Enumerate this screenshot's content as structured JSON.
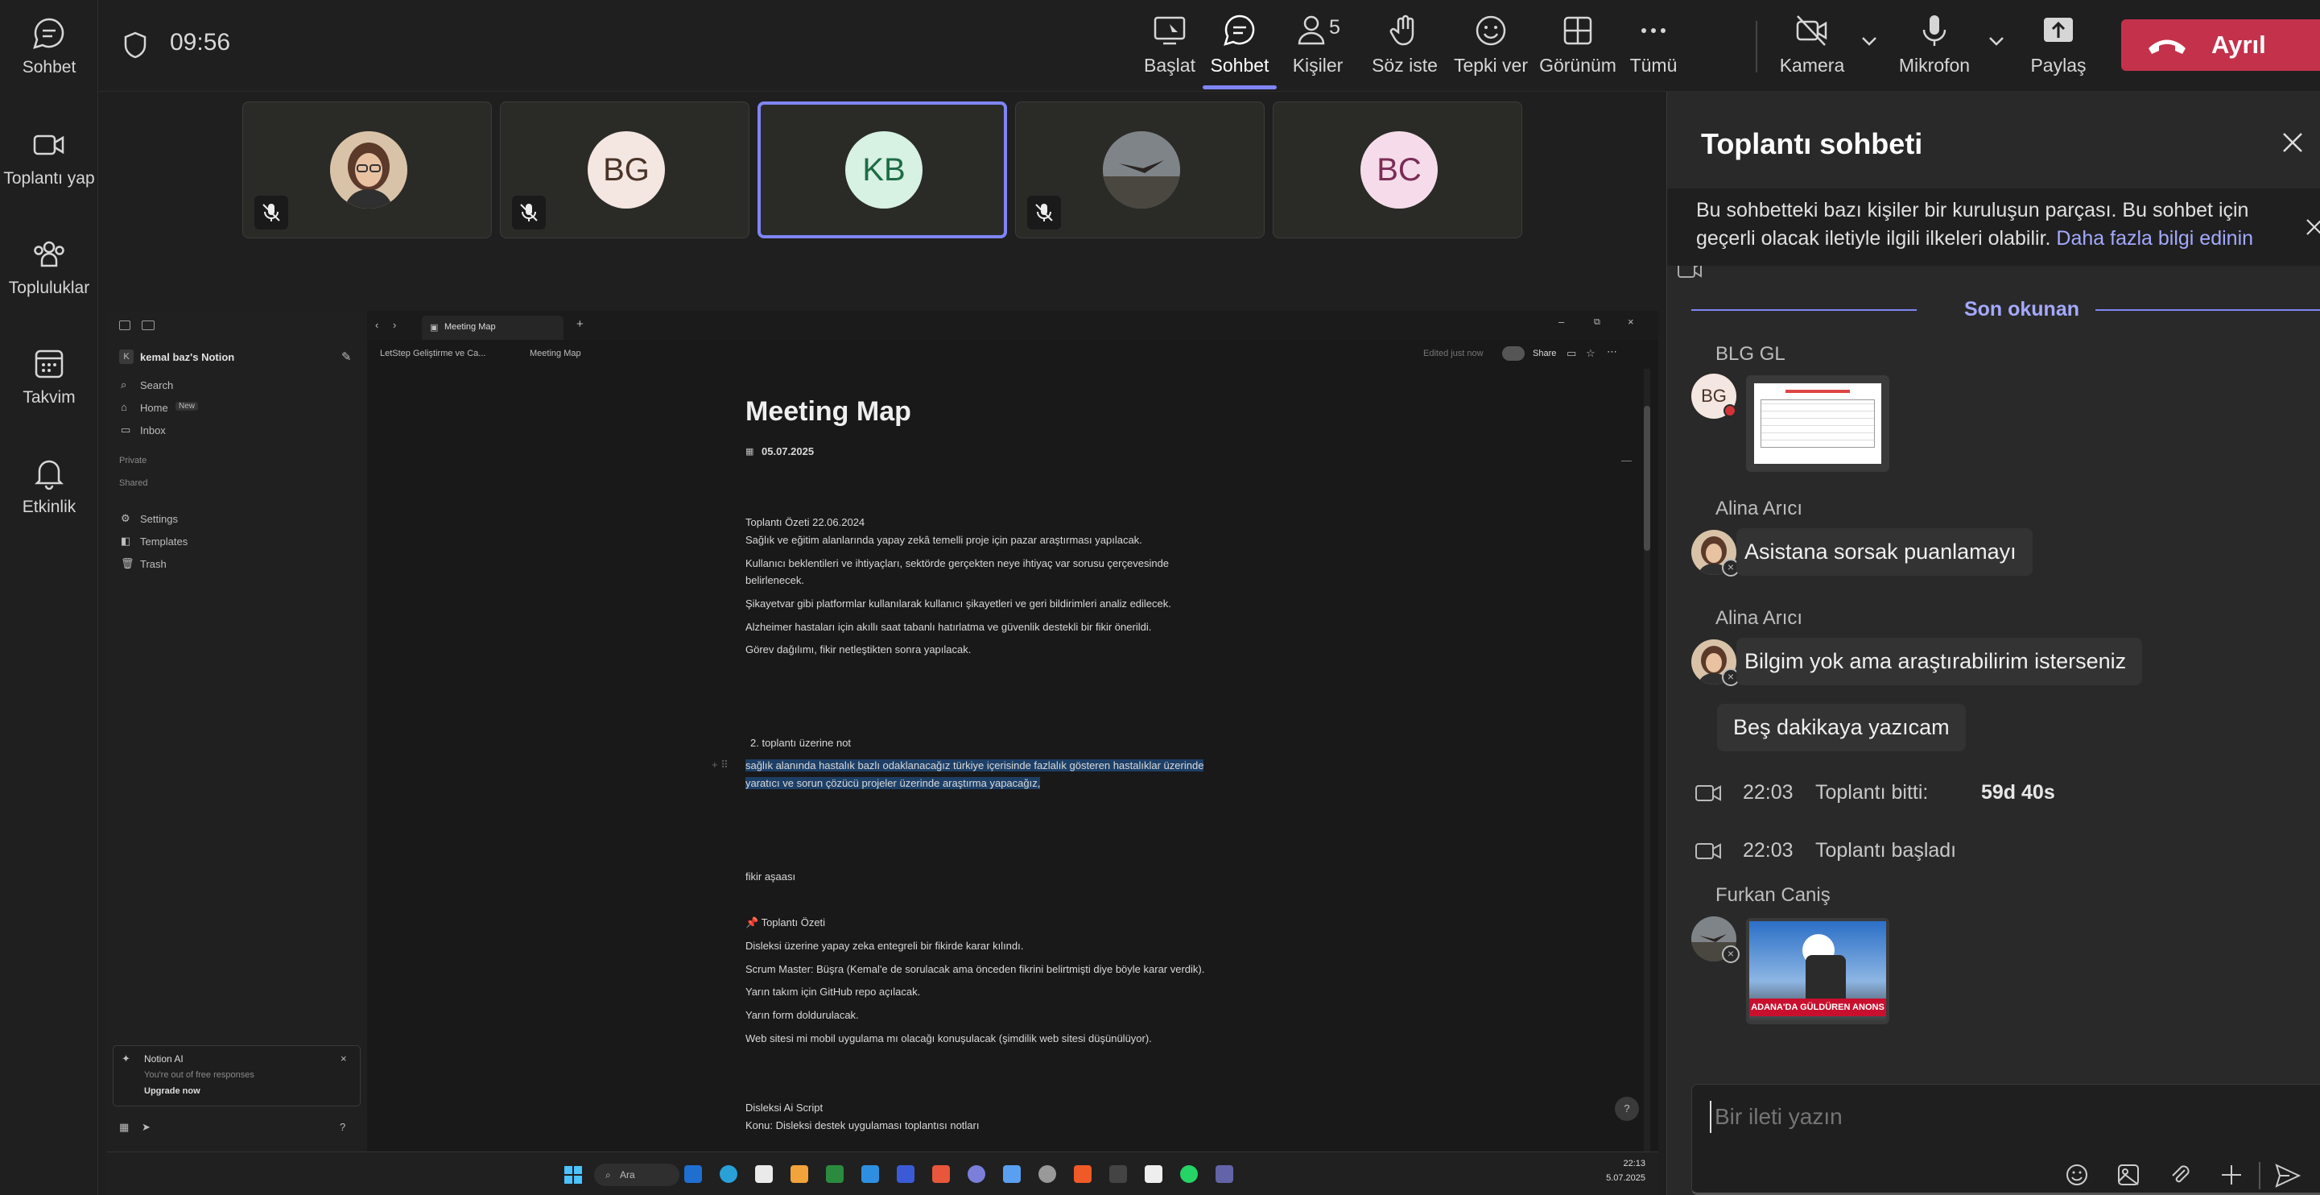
{
  "rail": {
    "items": [
      {
        "label": "Sohbet"
      },
      {
        "label": "Toplantı yap"
      },
      {
        "label": "Topluluklar"
      },
      {
        "label": "Takvim"
      },
      {
        "label": "Etkinlik"
      }
    ]
  },
  "topbar": {
    "timer": "09:56",
    "buttons": {
      "start": "Başlat",
      "chat": "Sohbet",
      "people": "Kişiler",
      "people_count": "5",
      "raise": "Söz iste",
      "react": "Tepki ver",
      "view": "Görünüm",
      "more": "Tümü",
      "camera": "Kamera",
      "mic": "Mikrofon",
      "share": "Paylaş"
    },
    "leave": "Ayrıl"
  },
  "participants": [
    {
      "initials": ""
    },
    {
      "initials": "BG"
    },
    {
      "initials": "KB"
    },
    {
      "initials": ""
    },
    {
      "initials": "BC"
    }
  ],
  "notion": {
    "workspace": "kemal baz's Notion",
    "workspace_initial": "K",
    "nav": {
      "search": "Search",
      "home": "Home",
      "home_badge": "New",
      "inbox": "Inbox"
    },
    "sections": {
      "private": "Private",
      "shared": "Shared"
    },
    "settings": {
      "settings": "Settings",
      "templates": "Templates",
      "trash": "Trash"
    },
    "ai": {
      "title": "Notion AI",
      "sub": "You're out of free responses",
      "cta": "Upgrade now"
    },
    "tab": "Meeting Map",
    "breadcrumb": {
      "parent": "LetStep Geliştirme ve Ca...",
      "page": "Meeting Map"
    },
    "edited": "Edited just now",
    "share": "Share",
    "title": "Meeting Map",
    "date": "05.07.2025",
    "lines": [
      "Toplantı Özeti 22.06.2024",
      "Sağlık ve eğitim alanlarında yapay zekâ temelli proje için pazar araştırması yapılacak.",
      "Kullanıcı beklentileri ve ihtiyaçları, sektörde gerçekten neye ihtiyaç var sorusu çerçevesinde",
      "belirlenecek.",
      "Şikayetvar gibi platformlar kullanılarak kullanıcı şikayetleri ve geri bildirimleri analiz edilecek.",
      "Alzheimer hastaları için akıllı saat tabanlı hatırlatma ve güvenlik destekli bir fikir önerildi.",
      "Görev dağılımı, fikir netleştikten sonra yapılacak."
    ],
    "numbered": "2.  toplantı üzerine not",
    "highlight": [
      "sağlık alanında hastalık bazlı odaklanacağız türkiye içerisinde fazlalık gösteren hastalıklar üzerinde",
      "yaratıcı ve sorun çözücü projeler üzerinde araştırma yapacağız,"
    ],
    "stage": "fikir aşaası",
    "summary_title": "📌 Toplantı Özeti",
    "summary": [
      "Disleksi üzerine yapay zeka entegreli bir fikirde karar kılındı.",
      "Scrum Master: Büşra (Kemal'e de sorulacak ama önceden fikrini belirtmişti diye böyle karar verdik).",
      "Yarın takım için GitHub repo açılacak.",
      "Yarın form doldurulacak.",
      "Web sitesi mi mobil uygulama mı olacağı konuşulacak (şimdilik web sitesi düşünülüyor)."
    ],
    "script_title": "Disleksi Ai Script",
    "script_sub": "Konu: Disleksi destek uygulaması toplantısı notları"
  },
  "taskbar": {
    "search": "Ara",
    "time": "22:13",
    "date": "5.07.2025"
  },
  "chat": {
    "title": "Toplantı sohbeti",
    "notice": "Bu sohbetteki bazı kişiler bir kuruluşun parçası. Bu sohbet için geçerli olacak iletiyle ilgili ilkeleri olabilir.",
    "notice_link": "Daha fazla bilgi edinin",
    "last_read": "Son okunan",
    "m1_author": "BLG GL",
    "m1_initials": "BG",
    "m2_author": "Alina Arıcı",
    "m2_text": "Asistana sorsak puanlamayı",
    "m3_author": "Alina Arıcı",
    "m3_text": "Bilgim yok ama araştırabilirim isterseniz",
    "m4_text": "Beş dakikaya yazıcam",
    "sys1_time": "22:03",
    "sys1_text": "Toplantı bitti:",
    "sys1_dur": "59d 40s",
    "sys2_time": "22:03",
    "sys2_text": "Toplantı başladı",
    "m5_author": "Furkan Caniş",
    "m5_caption": "ADANA'DA GÜLDÜREN ANONS",
    "input_placeholder": "Bir ileti yazın"
  },
  "colors": {
    "accent": "#7f85f5",
    "leave": "#c4314b",
    "highlight": "#1d3f66"
  }
}
